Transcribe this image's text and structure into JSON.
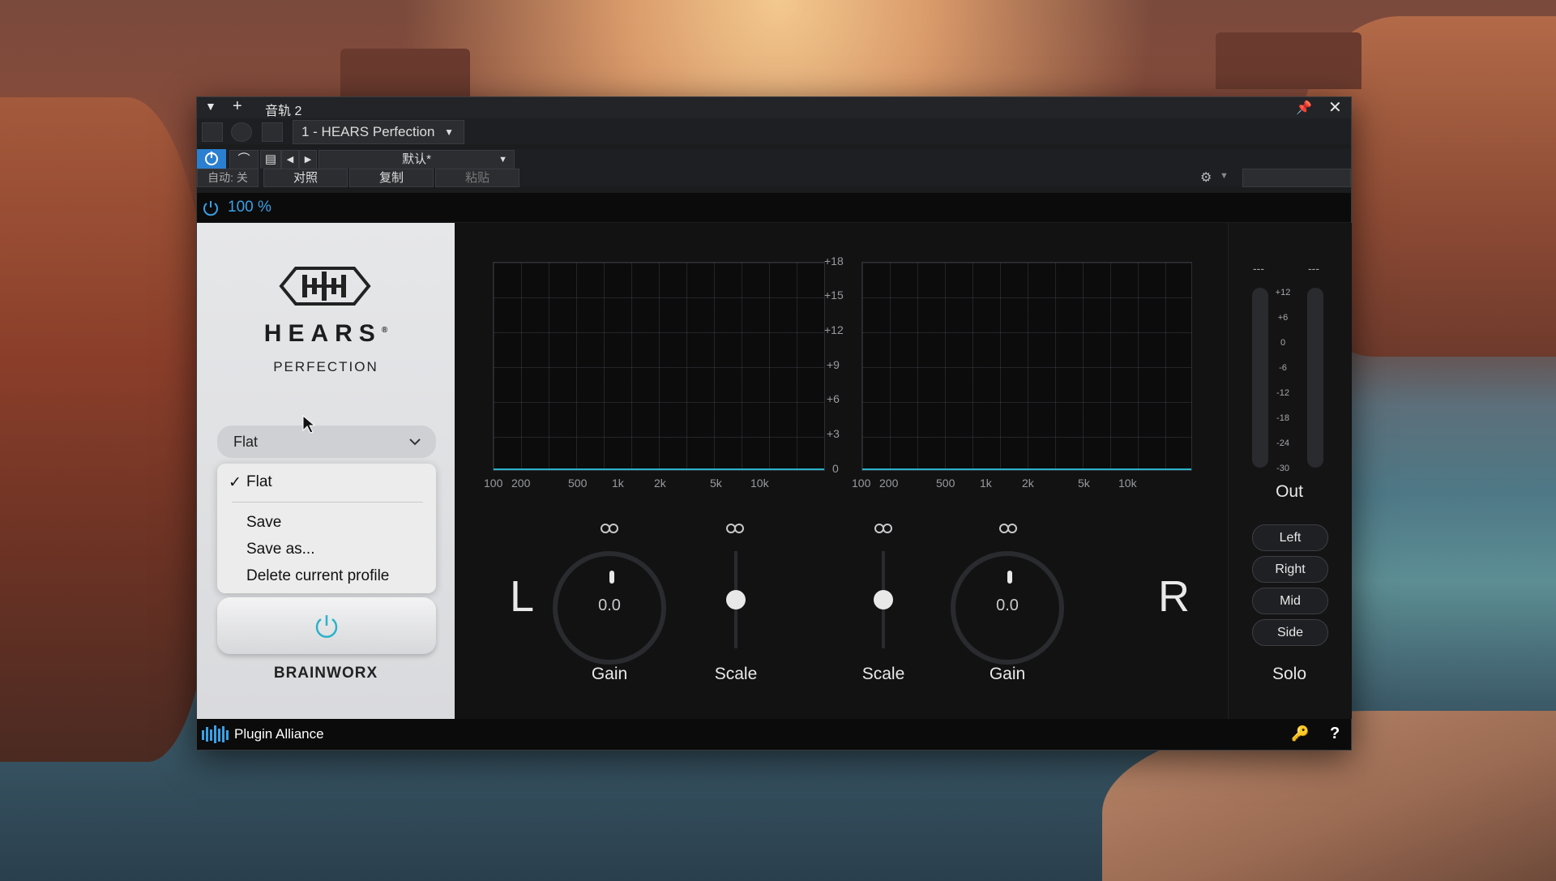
{
  "window": {
    "title": "音轨 2",
    "device_name": "1 - HEARS Perfection",
    "preset_name": "默认*",
    "auto_label": "自动: 关",
    "compare_label": "对照",
    "copy_label": "复制",
    "paste_label": "粘贴",
    "power_percent": "100 %"
  },
  "plugin": {
    "brand_title": "HEARS",
    "brand_sub": "PERFECTION",
    "brand_registered": "®",
    "profile_selected": "Flat",
    "profile_menu": {
      "checked_item": "Flat",
      "items": [
        "Save",
        "Save as...",
        "Delete current profile"
      ]
    },
    "maker": "BRAINWORX",
    "freq_ticks": [
      "100",
      "200",
      "500",
      "1k",
      "2k",
      "5k",
      "10k"
    ],
    "db_ticks": [
      "+18",
      "+15",
      "+12",
      "+9",
      "+6",
      "+3",
      "0"
    ],
    "left_channel": "L",
    "right_channel": "R",
    "left_gain": {
      "label": "Gain",
      "value": "0.0"
    },
    "left_scale": {
      "label": "Scale"
    },
    "right_scale": {
      "label": "Scale"
    },
    "right_gain": {
      "label": "Gain",
      "value": "0.0"
    },
    "meter": {
      "peak_left": "---",
      "peak_right": "---",
      "scale": [
        "+12",
        "+6",
        "0",
        "-6",
        "-12",
        "-18",
        "-24",
        "-30"
      ],
      "label": "Out"
    },
    "solo": {
      "buttons": [
        "Left",
        "Right",
        "Mid",
        "Side"
      ],
      "label": "Solo"
    }
  },
  "footer": {
    "brand": "Plugin Alliance",
    "help": "?"
  },
  "colors": {
    "accent_blue": "#3aa0e6",
    "curve_teal": "#2ab3c9"
  }
}
